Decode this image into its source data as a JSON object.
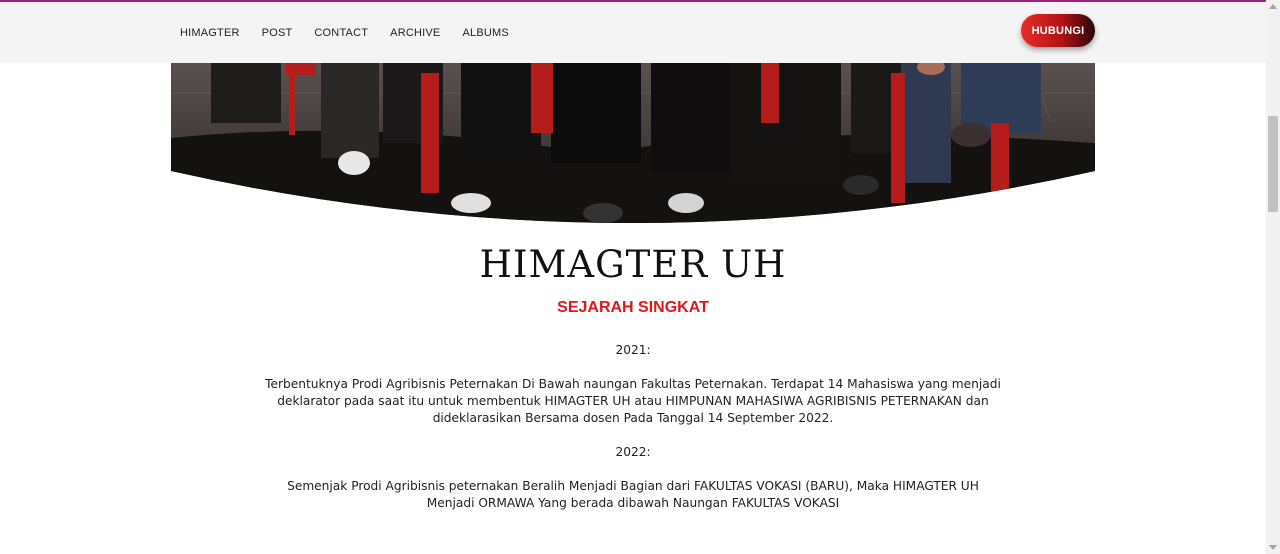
{
  "nav": {
    "items": [
      {
        "label": "HIMAGTER"
      },
      {
        "label": "POST"
      },
      {
        "label": "CONTACT"
      },
      {
        "label": "ARCHIVE"
      },
      {
        "label": "ALBUMS"
      }
    ],
    "cta_label": "HUBUNGI"
  },
  "colors": {
    "accent": "#e2161b",
    "nav_background": "#f4f4f4",
    "top_border": "#a0247a"
  },
  "main": {
    "title": "HIMAGTER UH",
    "subtitle": "SEJARAH SINGKAT",
    "sections": [
      {
        "year": "2021:",
        "text": "Terbentuknya Prodi Agribisnis Peternakan Di Bawah naungan Fakultas Peternakan. Terdapat 14 Mahasiswa yang menjadi deklarator pada saat itu untuk membentuk HIMAGTER UH atau HIMPUNAN MAHASIWA AGRIBISNIS PETERNAKAN dan dideklarasikan Bersama dosen Pada Tanggal 14 September 2022."
      },
      {
        "year": "2022:",
        "text": "Semenjak Prodi Agribisnis peternakan Beralih Menjadi Bagian dari FAKULTAS VOKASI (BARU), Maka HIMAGTER UH Menjadi ORMAWA Yang berada dibawah Naungan FAKULTAS VOKASI"
      }
    ]
  }
}
